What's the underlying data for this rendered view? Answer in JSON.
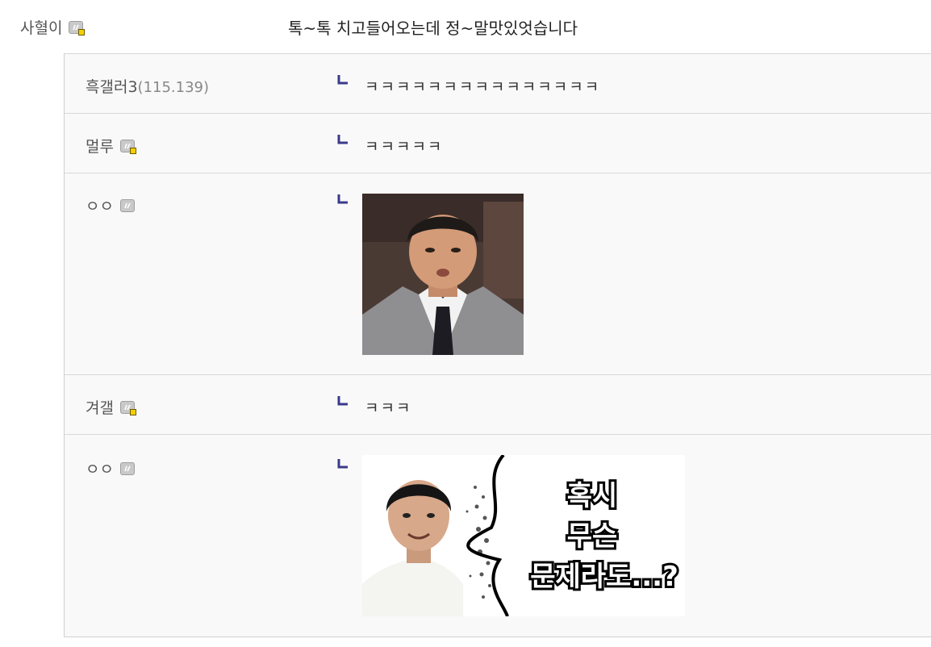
{
  "main_comment": {
    "nickname": "사혈이",
    "text": "톡~톡 치고들어오는데 정~말맛있엇습니다"
  },
  "replies": [
    {
      "nickname": "흑갤러",
      "nick_number": "3",
      "ip": "(115.139)",
      "text": "ㅋㅋㅋㅋㅋㅋㅋㅋㅋㅋㅋㅋㅋㅋㅋ"
    },
    {
      "nickname": "멀루",
      "text": "ㅋㅋㅋㅋㅋ"
    },
    {
      "nickname": "ㅇㅇ",
      "dccon": "chef-surprised-face"
    },
    {
      "nickname": "겨갤",
      "text": "ㅋㅋㅋ"
    },
    {
      "nickname": "ㅇㅇ",
      "dccon": "chef-speech-bubble",
      "dccon_text": [
        "혹시",
        "무슨",
        "문제라도...?"
      ]
    }
  ],
  "colors": {
    "reply_marker": "#3a3a8c",
    "badge_yellow": "#f5d000",
    "reply_bg": "#f9f9f9"
  }
}
